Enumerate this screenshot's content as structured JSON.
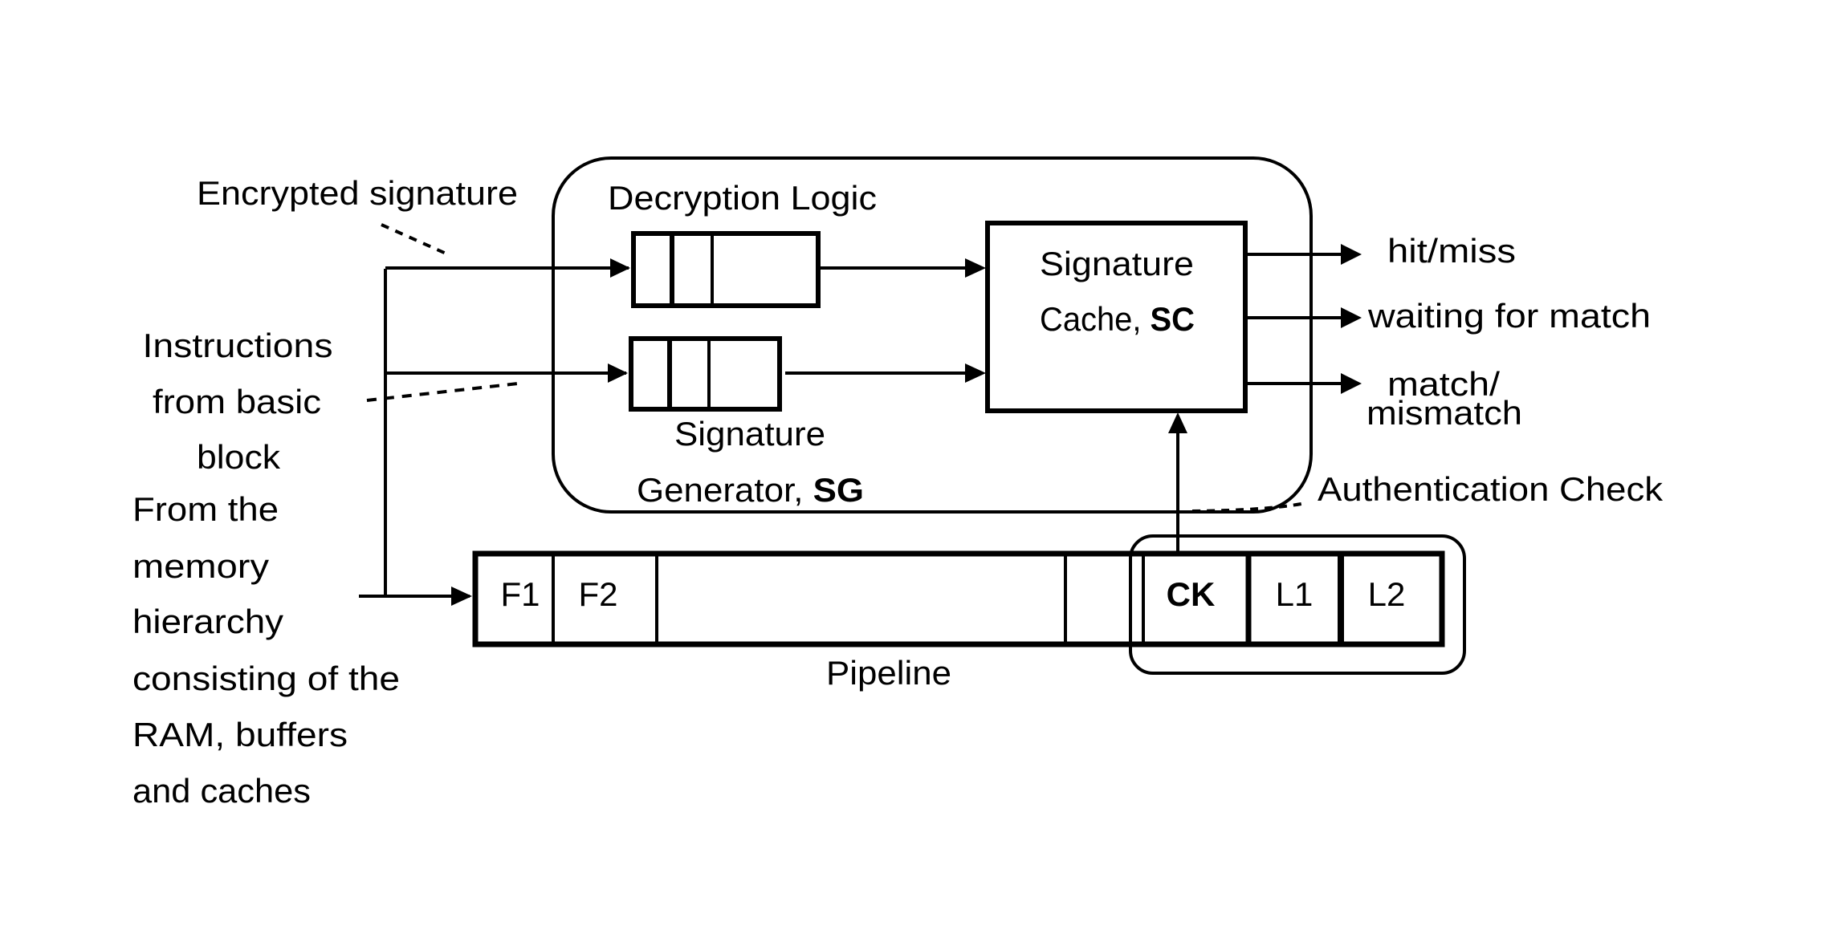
{
  "colors": {
    "stroke": "#000000",
    "background": "#ffffff"
  },
  "left_labels": {
    "encrypted_signature": "Encrypted signature",
    "instructions": [
      "Instructions",
      "from basic",
      "block"
    ],
    "memory": [
      "From the",
      "memory",
      "hierarchy",
      "consisting of the",
      "RAM, buffers",
      "and caches"
    ]
  },
  "core_block": {
    "decryption_logic": "Decryption Logic",
    "signature_generator": {
      "line1": "Signature",
      "line2_prefix": "Generator, ",
      "line2_bold": "SG"
    },
    "signature_cache": {
      "line1": "Signature",
      "line2_prefix": "Cache, ",
      "line2_bold": "SC"
    }
  },
  "outputs": {
    "hit_miss": "hit/miss",
    "waiting": "waiting for match",
    "match_line1": "match/",
    "match_line2": "mismatch"
  },
  "authentication_check": "Authentication Check",
  "pipeline": {
    "label": "Pipeline",
    "stages": [
      {
        "name": "F1",
        "bold": false
      },
      {
        "name": "F2",
        "bold": false
      },
      {
        "name": "",
        "bold": false
      },
      {
        "name": "",
        "bold": false
      },
      {
        "name": "CK",
        "bold": true
      },
      {
        "name": "L1",
        "bold": false
      },
      {
        "name": "L2",
        "bold": false
      }
    ]
  }
}
